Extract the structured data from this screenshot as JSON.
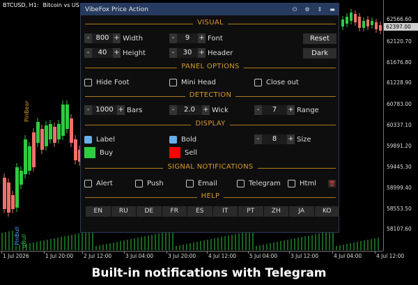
{
  "chart": {
    "symbol": "BTCUSD, H1:",
    "description": "Bitcoin vs US D",
    "current_price": "62397.00",
    "price_labels": [
      "62566.60",
      "62120.70",
      "61676.80",
      "61228.90",
      "60783.00",
      "60337.10",
      "59891.20",
      "59445.30",
      "58999.40",
      "58553.50",
      "58107.60"
    ],
    "time_labels": [
      "1 Jul 2026",
      "1 Jul 20:00",
      "2 Jul 12:00",
      "3 Jul 04:00",
      "3 Jul 20:00",
      "4 Jul 12:00",
      "5 Jul 04:00",
      "3 Jul 12:00",
      "4 Jul 04:00",
      "4 Jul 12:00"
    ],
    "marker_top": "PinBear",
    "marker_bottom": "PinBull",
    "marker_bottom2": "gBull",
    "colors": {
      "bull": "#2ecc40",
      "bear": "#f0706a",
      "volume": "#2ecc40",
      "accent": "#d79a2b"
    }
  },
  "panel": {
    "title": "VibeFox Price Action",
    "titlebar_icons": [
      "power-icon",
      "gear-icon",
      "arrows-icon",
      "minimize-icon"
    ],
    "visual": {
      "heading": "VISUAL",
      "width": {
        "value": "800",
        "label": "Width"
      },
      "height": {
        "value": "40",
        "label": "Height"
      },
      "font": {
        "value": "9",
        "label": "Font"
      },
      "header": {
        "value": "30",
        "label": "Header"
      },
      "reset_label": "Reset",
      "theme_label": "Dark"
    },
    "panel_options": {
      "heading": "PANEL OPTIONS",
      "items": [
        {
          "label": "Hide Foot",
          "checked": false
        },
        {
          "label": "Mini Head",
          "checked": false
        },
        {
          "label": "Close out",
          "checked": false
        }
      ]
    },
    "detection": {
      "heading": "DETECTION",
      "bars": {
        "value": "1000",
        "label": "Bars"
      },
      "wick": {
        "value": "2.0",
        "label": "Wick"
      },
      "range": {
        "value": "7",
        "label": "Range"
      }
    },
    "display": {
      "heading": "DISPLAY",
      "label_opt": {
        "label": "Label",
        "checked": true
      },
      "bold_opt": {
        "label": "Bold",
        "checked": true
      },
      "size": {
        "value": "8",
        "label": "Size"
      },
      "buy": {
        "label": "Buy",
        "color": "#2ecc40"
      },
      "sell": {
        "label": "Sell",
        "color": "#ff0000"
      }
    },
    "notifications": {
      "heading": "SIGNAL NOTIFICATIONS",
      "items": [
        {
          "label": "Alert",
          "checked": false
        },
        {
          "label": "Push",
          "checked": false
        },
        {
          "label": "Email",
          "checked": false
        },
        {
          "label": "Telegram",
          "checked": false
        },
        {
          "label": "Html",
          "checked": false
        }
      ]
    },
    "help": {
      "heading": "HELP",
      "languages": [
        "EN",
        "RU",
        "DE",
        "FR",
        "ES",
        "IT",
        "PT",
        "ZH",
        "JA",
        "KO"
      ]
    }
  },
  "caption": "Built-in notifications with Telegram"
}
